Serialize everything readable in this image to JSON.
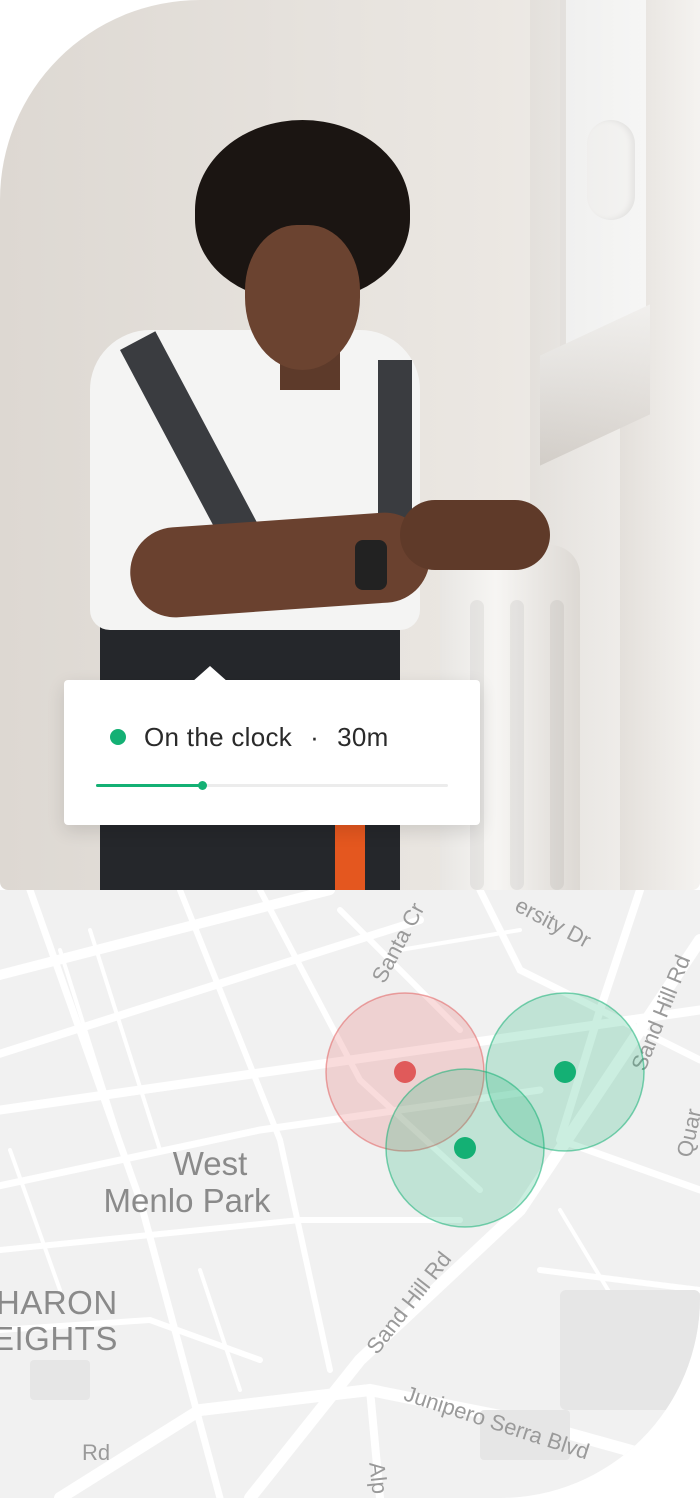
{
  "status": {
    "state_label": "On the clock",
    "separator": "·",
    "duration": "30m",
    "progress": 0.3,
    "accent_color": "#14b074"
  },
  "map": {
    "places": {
      "west": "West",
      "menlo_park": "Menlo Park",
      "haron": "HARON",
      "eights": "EIGHTS"
    },
    "roads": {
      "santa_cruz": "Santa Cr",
      "university_dr": "ersity Dr",
      "sand_hill_rd_1": "Sand Hill Rd",
      "sand_hill_rd_2": "Sand Hill Rd",
      "quarry": "Quar",
      "junipero": "Junipero Serra Blvd",
      "alp": "Alp",
      "rd": "Rd"
    },
    "geofences": [
      {
        "name": "red-zone",
        "color": "#e05a5a"
      },
      {
        "name": "green-zone-center",
        "color": "#14b074"
      },
      {
        "name": "green-zone-right",
        "color": "#14b074"
      }
    ]
  }
}
